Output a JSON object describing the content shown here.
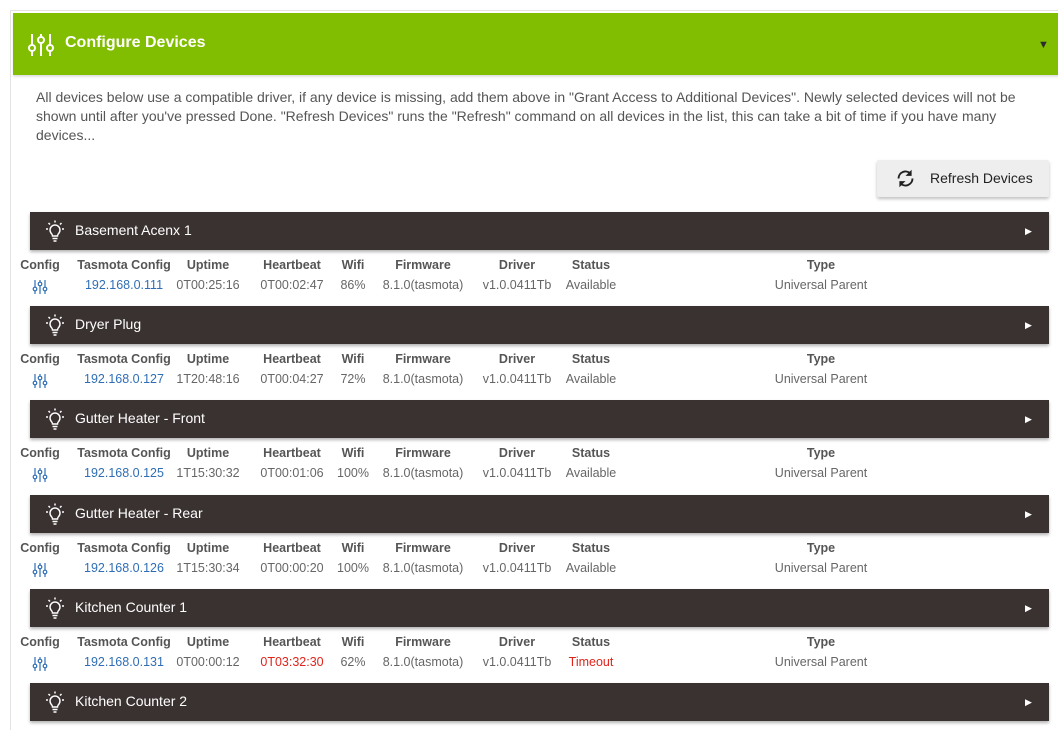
{
  "header": {
    "title": "Configure Devices",
    "icon": "sliders-icon",
    "caret": "▼"
  },
  "intro": "All devices below use a compatible driver, if any device is missing, add them above in \"Grant Access to Additional Devices\". Newly selected devices will not be shown until after you've pressed Done. \"Refresh Devices\" runs the \"Refresh\" command on all devices in the list, this can take a bit of time if you have many devices...",
  "refresh_button": {
    "label": "Refresh Devices",
    "icon": "refresh-icon"
  },
  "columns": [
    "Config",
    "Tasmota Config",
    "Uptime",
    "Heartbeat",
    "Wifi",
    "Firmware",
    "Driver",
    "Status",
    "Type"
  ],
  "colors": {
    "header_bg": "#81bd00",
    "device_bar_bg": "#3a3230",
    "link": "#2f6eb5",
    "alert": "#e0241b"
  },
  "devices": [
    {
      "name": "Basement Acenx 1",
      "ip": "192.168.0.111",
      "uptime": "0T00:25:16",
      "heartbeat": "0T00:02:47",
      "heartbeat_alert": false,
      "wifi": "86%",
      "firmware": "8.1.0(tasmota)",
      "driver": "v1.0.0411Tb",
      "status": "Available",
      "status_alert": false,
      "type": "Universal Parent"
    },
    {
      "name": "Dryer Plug",
      "ip": "192.168.0.127",
      "uptime": "1T20:48:16",
      "heartbeat": "0T00:04:27",
      "heartbeat_alert": false,
      "wifi": "72%",
      "firmware": "8.1.0(tasmota)",
      "driver": "v1.0.0411Tb",
      "status": "Available",
      "status_alert": false,
      "type": "Universal Parent"
    },
    {
      "name": "Gutter Heater - Front",
      "ip": "192.168.0.125",
      "uptime": "1T15:30:32",
      "heartbeat": "0T00:01:06",
      "heartbeat_alert": false,
      "wifi": "100%",
      "firmware": "8.1.0(tasmota)",
      "driver": "v1.0.0411Tb",
      "status": "Available",
      "status_alert": false,
      "type": "Universal Parent"
    },
    {
      "name": "Gutter Heater - Rear",
      "ip": "192.168.0.126",
      "uptime": "1T15:30:34",
      "heartbeat": "0T00:00:20",
      "heartbeat_alert": false,
      "wifi": "100%",
      "firmware": "8.1.0(tasmota)",
      "driver": "v1.0.0411Tb",
      "status": "Available",
      "status_alert": false,
      "type": "Universal Parent"
    },
    {
      "name": "Kitchen Counter 1",
      "ip": "192.168.0.131",
      "uptime": "0T00:00:12",
      "heartbeat": "0T03:32:30",
      "heartbeat_alert": true,
      "wifi": "62%",
      "firmware": "8.1.0(tasmota)",
      "driver": "v1.0.0411Tb",
      "status": "Timeout",
      "status_alert": true,
      "type": "Universal Parent"
    },
    {
      "name": "Kitchen Counter 2"
    }
  ]
}
